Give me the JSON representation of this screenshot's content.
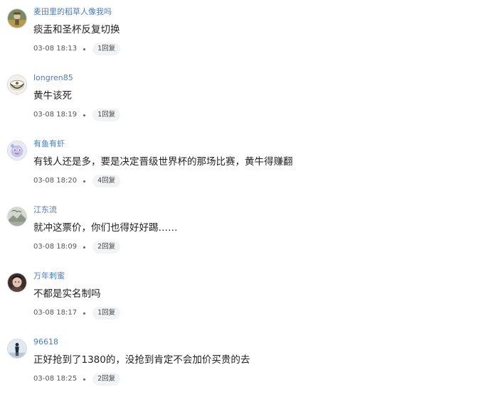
{
  "comments": [
    {
      "username": "麦田里的稻草人像我吗",
      "text": "痰盂和圣杯反复切换",
      "time": "03-08 18:13",
      "replies": "1回复",
      "avatar_icon": "avatar-scarecrow-icon"
    },
    {
      "username": "longren85",
      "text": "黄牛该死",
      "time": "03-08 18:19",
      "replies": "1回复",
      "avatar_icon": "avatar-cup-icon"
    },
    {
      "username": "有鱼有虾",
      "text": "有钱人还是多，要是决定晋级世界杯的那场比赛，黄牛得赚翻",
      "time": "03-08 18:20",
      "replies": "4回复",
      "avatar_icon": "avatar-cartoon-icon"
    },
    {
      "username": "江东流",
      "text": "就冲这票价，你们也得好好踢……",
      "time": "03-08 18:09",
      "replies": "2回复",
      "avatar_icon": "avatar-landscape-icon"
    },
    {
      "username": "万年刺蜜",
      "text": "不都是实名制吗",
      "time": "03-08 18:17",
      "replies": "1回复",
      "avatar_icon": "avatar-portrait-icon"
    },
    {
      "username": "96618",
      "text": "正好抢到了1380的，没抢到肯定不会加价买贵的去",
      "time": "03-08 18:25",
      "replies": "2回复",
      "avatar_icon": "avatar-figure-icon"
    }
  ],
  "colors": {
    "username": "#4a7bbf",
    "text": "#1f1f1f",
    "meta": "#555555",
    "badge_bg": "#f2f3f5"
  }
}
